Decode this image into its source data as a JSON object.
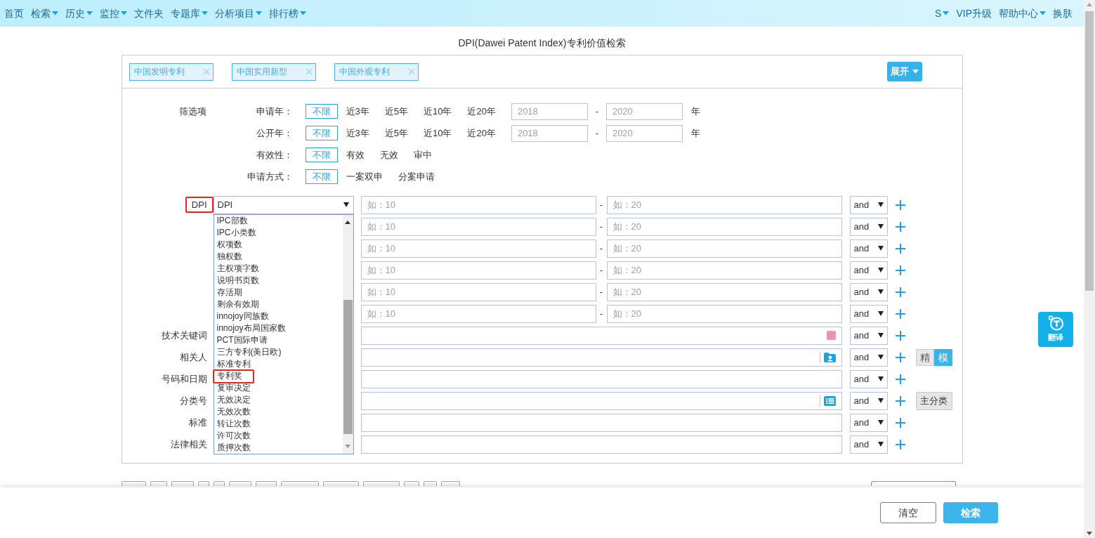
{
  "nav": {
    "left": [
      {
        "label": "首页",
        "menu": false
      },
      {
        "label": "检索",
        "menu": true
      },
      {
        "label": "历史",
        "menu": true
      },
      {
        "label": "监控",
        "menu": true
      },
      {
        "label": "文件夹",
        "menu": false
      },
      {
        "label": "专题库",
        "menu": true
      },
      {
        "label": "分析项目",
        "menu": true
      },
      {
        "label": "排行榜",
        "menu": true
      }
    ],
    "right": [
      {
        "label": "S",
        "menu": true
      },
      {
        "label": "VIP升级",
        "menu": false
      },
      {
        "label": "帮助中心",
        "menu": true
      },
      {
        "label": "换肤",
        "menu": false
      }
    ]
  },
  "title": "DPI(Dawei Patent Index)专利价值检索",
  "patent_types": [
    {
      "label": "中国发明专利"
    },
    {
      "label": "中国实用新型"
    },
    {
      "label": "中国外观专利"
    }
  ],
  "expand_button": {
    "label": "展开",
    "menu": true
  },
  "filters": {
    "label": "筛选项",
    "rows": [
      {
        "label": "申请年：",
        "options": [
          {
            "label": "不限",
            "selected": true
          },
          {
            "label": "近3年",
            "selected": false
          },
          {
            "label": "近5年",
            "selected": false
          },
          {
            "label": "近10年",
            "selected": false
          },
          {
            "label": "近20年",
            "selected": false
          }
        ],
        "range": {
          "from": {
            "placeholder": "2018"
          },
          "separator": "-",
          "to": {
            "placeholder": "2020"
          },
          "unit": "年"
        }
      },
      {
        "label": "公开年：",
        "options": [
          {
            "label": "不限",
            "selected": true
          },
          {
            "label": "近3年",
            "selected": false
          },
          {
            "label": "近5年",
            "selected": false
          },
          {
            "label": "近10年",
            "selected": false
          },
          {
            "label": "近20年",
            "selected": false
          }
        ],
        "range": {
          "from": {
            "placeholder": "2018"
          },
          "separator": "-",
          "to": {
            "placeholder": "2020"
          },
          "unit": "年"
        }
      },
      {
        "label": "有效性：",
        "options": [
          {
            "label": "不限",
            "selected": true
          },
          {
            "label": "有效",
            "selected": false
          },
          {
            "label": "无效",
            "selected": false
          },
          {
            "label": "审中",
            "selected": false
          }
        ]
      },
      {
        "label": "申请方式：",
        "options": [
          {
            "label": "不限",
            "selected": true
          },
          {
            "label": "一案双申",
            "selected": false
          },
          {
            "label": "分案申请",
            "selected": false
          }
        ]
      }
    ]
  },
  "criteria": {
    "rows": [
      {
        "label": "DPI",
        "highlighted": true,
        "field": {
          "value": "DPI",
          "expanded": true,
          "options": [
            {
              "label": "IPC部数",
              "highlighted": false
            },
            {
              "label": "IPC小类数",
              "highlighted": false
            },
            {
              "label": "权项数",
              "highlighted": false
            },
            {
              "label": "独权数",
              "highlighted": false
            },
            {
              "label": "主权项字数",
              "highlighted": false
            },
            {
              "label": "说明书页数",
              "highlighted": false
            },
            {
              "label": "存活期",
              "highlighted": false
            },
            {
              "label": "剩余有效期",
              "highlighted": false
            },
            {
              "label": "innojoy同族数",
              "highlighted": false
            },
            {
              "label": "innojoy布局国家数",
              "highlighted": false
            },
            {
              "label": "PCT国际申请",
              "highlighted": false
            },
            {
              "label": "三方专利(美日欧)",
              "highlighted": false
            },
            {
              "label": "标准专利",
              "highlighted": false
            },
            {
              "label": "专利奖",
              "highlighted": true
            },
            {
              "label": "复审决定",
              "highlighted": false
            },
            {
              "label": "无效决定",
              "highlighted": false
            },
            {
              "label": "无效次数",
              "highlighted": false
            },
            {
              "label": "转让次数",
              "highlighted": false
            },
            {
              "label": "许可次数",
              "highlighted": false
            },
            {
              "label": "质押次数",
              "highlighted": false
            }
          ]
        },
        "kind": "range",
        "from": {
          "placeholder": "如：10"
        },
        "separator": "-",
        "to": {
          "placeholder": "如：20"
        },
        "operator": "and"
      },
      {
        "highlighted": false,
        "kind": "range",
        "from": {
          "placeholder": "如：10"
        },
        "separator": "-",
        "to": {
          "placeholder": "如：20"
        },
        "operator": "and"
      },
      {
        "highlighted": false,
        "kind": "range",
        "from": {
          "placeholder": "如：10"
        },
        "separator": "-",
        "to": {
          "placeholder": "如：20"
        },
        "operator": "and"
      },
      {
        "highlighted": false,
        "kind": "range",
        "from": {
          "placeholder": "如：10"
        },
        "separator": "-",
        "to": {
          "placeholder": "如：20"
        },
        "operator": "and"
      },
      {
        "highlighted": false,
        "kind": "range",
        "from": {
          "placeholder": "如：10"
        },
        "separator": "-",
        "to": {
          "placeholder": "如：20"
        },
        "operator": "and"
      },
      {
        "highlighted": false,
        "kind": "range",
        "from": {
          "placeholder": "如：10"
        },
        "separator": "-",
        "to": {
          "placeholder": "如：20"
        },
        "operator": "and"
      },
      {
        "label": "技术关键词",
        "highlighted": false,
        "kind": "text",
        "addon": {
          "kind": "swatch"
        },
        "operator": "and"
      },
      {
        "label": "相关人",
        "highlighted": false,
        "kind": "text",
        "addon": {
          "kind": "person"
        },
        "operator": "and",
        "toggle": [
          {
            "label": "精",
            "selected": false
          },
          {
            "label": "模",
            "selected": true
          }
        ]
      },
      {
        "label": "号码和日期",
        "highlighted": false,
        "kind": "text",
        "operator": "and"
      },
      {
        "label": "分类号",
        "highlighted": false,
        "kind": "text",
        "addon": {
          "kind": "list"
        },
        "operator": "and",
        "button": {
          "label": "主分类"
        }
      },
      {
        "label": "标准",
        "highlighted": false,
        "kind": "text",
        "operator": "and"
      },
      {
        "label": "法律相关",
        "highlighted": false,
        "kind": "text",
        "operator": "and"
      }
    ]
  },
  "footer": {
    "buttons": [
      {
        "label": "清空",
        "kind": "secondary"
      },
      {
        "label": "检索",
        "kind": "primary"
      }
    ]
  },
  "translate_button": {
    "label": "翻译"
  }
}
